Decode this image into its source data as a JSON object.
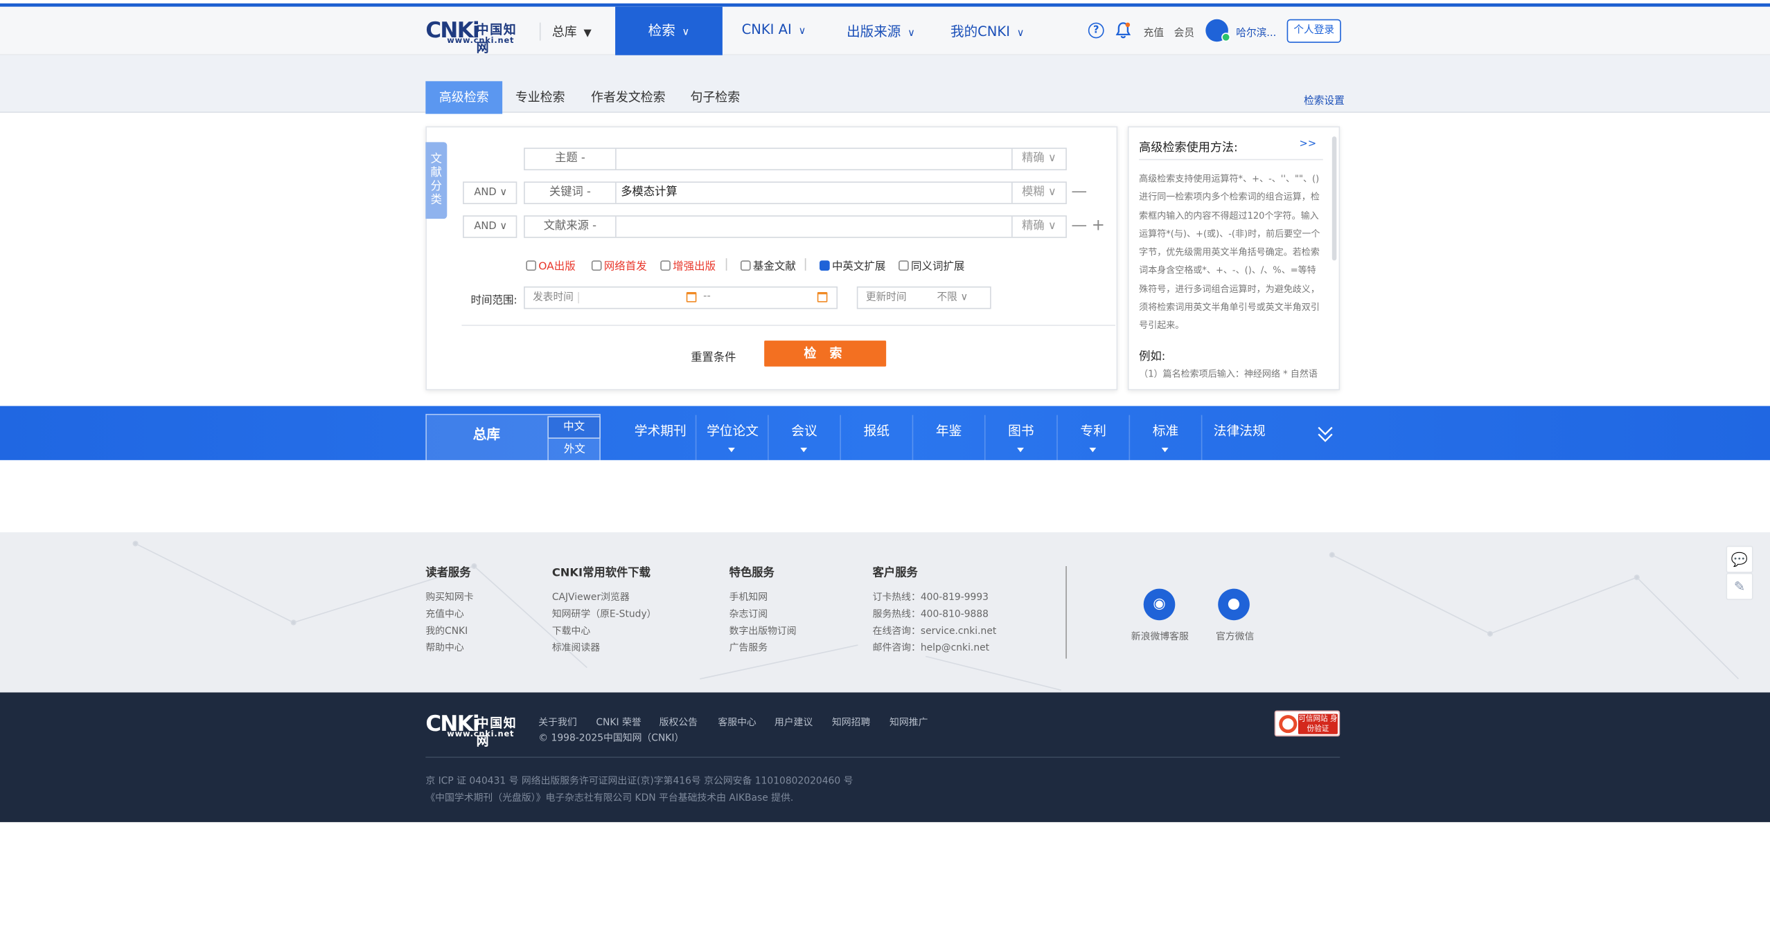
{
  "header": {
    "logo": {
      "mark": "CNKi",
      "cn": "中国知网",
      "url": "www.cnki.net"
    },
    "library_select": "总库",
    "nav": [
      {
        "label": "检索"
      },
      {
        "label": "CNKI AI"
      },
      {
        "label": "出版来源"
      },
      {
        "label": "我的CNKI"
      }
    ],
    "recharge": "充值",
    "member": "会员",
    "username": "哈尔滨...",
    "login_button": "个人登录",
    "help_glyph": "?"
  },
  "search_tabs": {
    "tabs": [
      "高级检索",
      "专业检索",
      "作者发文检索",
      "句子检索"
    ],
    "active": "高级检索",
    "settings": "检索设置"
  },
  "side_tab": "文献分类",
  "search_rows": [
    {
      "operator": "",
      "field": "主题 -",
      "value": "",
      "mode": "精确 ∨"
    },
    {
      "operator": "AND ∨",
      "field": "关键词 -",
      "value": "多模态计算",
      "mode": "模糊 ∨"
    },
    {
      "operator": "AND ∨",
      "field": "文献来源 -",
      "value": "",
      "mode": "精确 ∨"
    }
  ],
  "row_buttons": {
    "remove": "—",
    "add": "+"
  },
  "options": [
    {
      "label": "OA出版",
      "checked": false,
      "color": "#e8372b"
    },
    {
      "label": "网络首发",
      "checked": false,
      "color": "#e8372b"
    },
    {
      "label": "增强出版",
      "checked": false,
      "color": "#e8372b"
    },
    {
      "label": "基金文献",
      "checked": false,
      "color": "#333333"
    },
    {
      "label": "中英文扩展",
      "checked": true,
      "color": "#333333"
    },
    {
      "label": "同义词扩展",
      "checked": false,
      "color": "#333333"
    }
  ],
  "time_range": {
    "label": "时间范围:",
    "publish_placeholder": "发表时间",
    "separator": "--",
    "update_label": "更新时间",
    "update_value": "不限 ∨"
  },
  "actions": {
    "reset": "重置条件",
    "search": "检 索"
  },
  "help_panel": {
    "title": "高级检索使用方法:",
    "more": ">>",
    "body": "高级检索支持使用运算符*、+、-、''、\"\"、()进行同一检索项内多个检索词的组合运算，检索框内输入的内容不得超过120个字符。输入运算符*(与)、+(或)、-(非)时，前后要空一个字节，优先级需用英文半角括号确定。若检索词本身含空格或*、+、-、()、/、%、=等特殊符号，进行多词组合运算时，为避免歧义，须将检索词用英文半角单引号或英文半角双引号引起来。",
    "example_title": "例如:",
    "example_line": "（1）篇名检索项后输入：神经网络 * 自然语"
  },
  "categories": {
    "main": "总库",
    "lang_zh": "中文",
    "lang_foreign": "外文",
    "items": [
      {
        "label": "学术期刊",
        "has_arrow": false
      },
      {
        "label": "学位论文",
        "has_arrow": true
      },
      {
        "label": "会议",
        "has_arrow": true
      },
      {
        "label": "报纸",
        "has_arrow": false
      },
      {
        "label": "年鉴",
        "has_arrow": false
      },
      {
        "label": "图书",
        "has_arrow": true
      },
      {
        "label": "专利",
        "has_arrow": true
      },
      {
        "label": "标准",
        "has_arrow": true
      },
      {
        "label": "法律法规",
        "has_arrow": false
      }
    ]
  },
  "footer": {
    "columns": [
      {
        "title": "读者服务",
        "links": [
          "购买知网卡",
          "充值中心",
          "我的CNKI",
          "帮助中心"
        ]
      },
      {
        "title": "CNKI常用软件下载",
        "links": [
          "CAJViewer浏览器",
          "知网研学（原E-Study）",
          "下载中心",
          "标准阅读器"
        ]
      },
      {
        "title": "特色服务",
        "links": [
          "手机知网",
          "杂志订阅",
          "数字出版物订阅",
          "广告服务"
        ]
      },
      {
        "title": "客户服务",
        "links": [
          "订卡热线：400-819-9993",
          "服务热线：400-810-9888",
          "在线咨询：service.cnki.net",
          "邮件咨询：help@cnki.net"
        ]
      }
    ],
    "social": [
      {
        "label": "新浪微博客服",
        "icon": "weibo-icon"
      },
      {
        "label": "官方微信",
        "icon": "wechat-icon"
      }
    ]
  },
  "bottom": {
    "links": [
      "关于我们",
      "CNKI 荣誉",
      "版权公告",
      "客服中心",
      "用户建议",
      "知网招聘",
      "知网推广"
    ],
    "copyright": "© 1998-2025中国知网（CNKI）",
    "trust_badge": "可信网站 身份验证",
    "icp": "京 ICP 证 040431 号 网络出版服务许可证网出证(京)字第416号 京公网安备 11010802020460 号",
    "publisher": "《中国学术期刊（光盘版）》电子杂志社有限公司 KDN 平台基础技术由 AIKBase 提供."
  }
}
